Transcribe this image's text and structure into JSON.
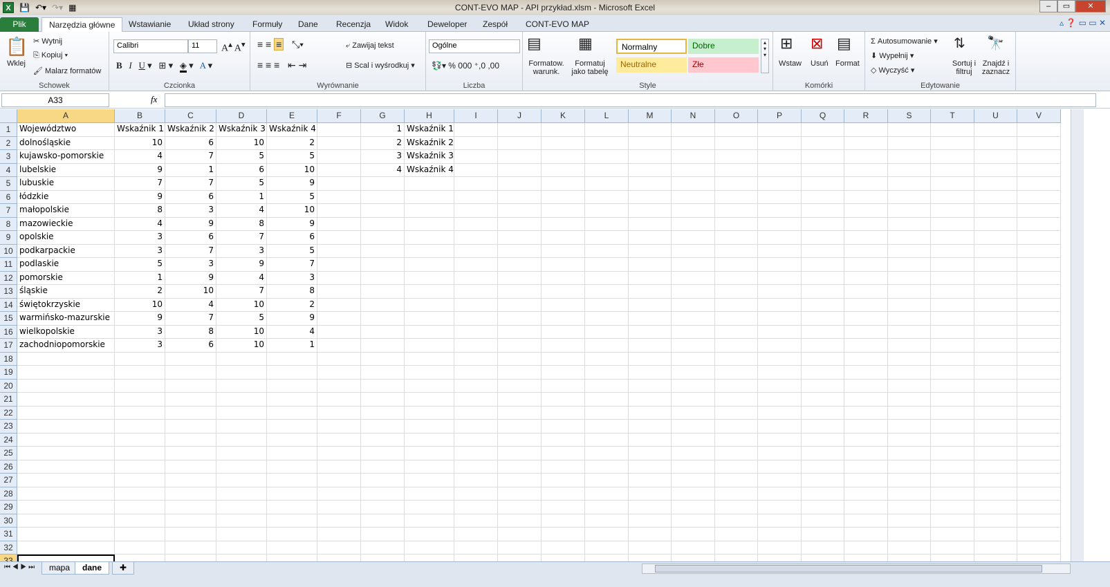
{
  "window": {
    "title": "CONT-EVO MAP - API przykład.xlsm - Microsoft Excel"
  },
  "tabs": [
    "Plik",
    "Narzędzia główne",
    "Wstawianie",
    "Układ strony",
    "Formuły",
    "Dane",
    "Recenzja",
    "Widok",
    "Deweloper",
    "Zespół",
    "CONT-EVO MAP"
  ],
  "ribbon": {
    "clipboard": {
      "label": "Schowek",
      "paste": "Wklej",
      "cut": "Wytnij",
      "copy": "Kopiuj",
      "painter": "Malarz formatów"
    },
    "font": {
      "label": "Czcionka",
      "name": "Calibri",
      "size": "11"
    },
    "alignment": {
      "label": "Wyrównanie",
      "wrap": "Zawijaj tekst",
      "merge": "Scal i wyśrodkuj"
    },
    "number": {
      "label": "Liczba",
      "format": "Ogólne"
    },
    "styles": {
      "label": "Style",
      "cond": "Formatow. warunk.",
      "table": "Formatuj jako tabelę",
      "normal": "Normalny",
      "good": "Dobre",
      "neutral": "Neutralne",
      "bad": "Złe"
    },
    "cells": {
      "label": "Komórki",
      "insert": "Wstaw",
      "delete": "Usuń",
      "format": "Format"
    },
    "editing": {
      "label": "Edytowanie",
      "autosum": "Autosumowanie",
      "fill": "Wypełnij",
      "clear": "Wyczyść",
      "sort": "Sortuj i filtruj",
      "find": "Znajdź i zaznacz"
    }
  },
  "formula_bar": {
    "name_box": "A33",
    "fx": "fx",
    "value": ""
  },
  "columns": [
    "A",
    "B",
    "C",
    "D",
    "E",
    "F",
    "G",
    "H",
    "I",
    "J",
    "K",
    "L",
    "M",
    "N",
    "O",
    "P",
    "Q",
    "R",
    "S",
    "T",
    "U",
    "V"
  ],
  "cells": [
    [
      "Województwo",
      "Wskaźnik 1",
      "Wskaźnik 2",
      "Wskaźnik 3",
      "Wskaźnik 4",
      "",
      1,
      "Wskaźnik 1"
    ],
    [
      "dolnośląskie",
      10,
      6,
      10,
      2,
      "",
      2,
      "Wskaźnik 2"
    ],
    [
      "kujawsko-pomorskie",
      4,
      7,
      5,
      5,
      "",
      3,
      "Wskaźnik 3"
    ],
    [
      "lubelskie",
      9,
      1,
      6,
      10,
      "",
      4,
      "Wskaźnik 4"
    ],
    [
      "lubuskie",
      7,
      7,
      5,
      9
    ],
    [
      "łódzkie",
      9,
      6,
      1,
      5
    ],
    [
      "małopolskie",
      8,
      3,
      4,
      10
    ],
    [
      "mazowieckie",
      4,
      9,
      8,
      9
    ],
    [
      "opolskie",
      3,
      6,
      7,
      6
    ],
    [
      "podkarpackie",
      3,
      7,
      3,
      5
    ],
    [
      "podlaskie",
      5,
      3,
      9,
      7
    ],
    [
      "pomorskie",
      1,
      9,
      4,
      3
    ],
    [
      "śląskie",
      2,
      10,
      7,
      8
    ],
    [
      "świętokrzyskie",
      10,
      4,
      10,
      2
    ],
    [
      "warmińsko-mazurskie",
      9,
      7,
      5,
      9
    ],
    [
      "wielkopolskie",
      3,
      8,
      10,
      4
    ],
    [
      "zachodniopomorskie",
      3,
      6,
      10,
      1
    ]
  ],
  "selected_cell": "A33",
  "sheets": [
    {
      "name": "mapa",
      "active": false
    },
    {
      "name": "dane",
      "active": true
    }
  ],
  "colors": {
    "accent": "#2a7e3c",
    "selection": "#f8d884",
    "good_bg": "#c6efce",
    "neutral_bg": "#ffeb9c",
    "bad_bg": "#ffc7ce"
  }
}
